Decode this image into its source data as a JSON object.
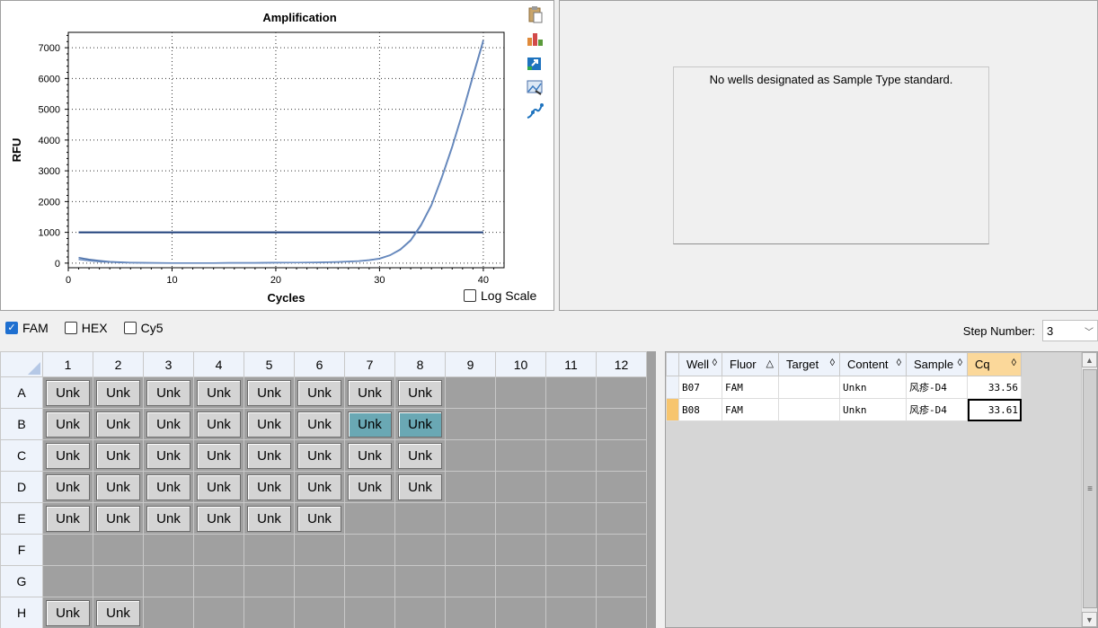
{
  "chart_data": {
    "type": "line",
    "title": "Amplification",
    "xlabel": "Cycles",
    "ylabel": "RFU",
    "xlim": [
      0,
      42
    ],
    "ylim": [
      -150,
      7500
    ],
    "x_ticks": [
      0,
      10,
      20,
      30,
      40
    ],
    "y_ticks": [
      0,
      1000,
      2000,
      3000,
      4000,
      5000,
      6000,
      7000
    ],
    "grid": true,
    "threshold": 1000,
    "series": [
      {
        "values_x": [
          1,
          2,
          3,
          4,
          5,
          6,
          8,
          10,
          12,
          14,
          16,
          18,
          20,
          22,
          24,
          26,
          28,
          29,
          30,
          31,
          32,
          33,
          34,
          35,
          36,
          37,
          38,
          39,
          40
        ],
        "values_y": [
          180,
          120,
          80,
          50,
          30,
          20,
          10,
          5,
          5,
          5,
          10,
          10,
          15,
          20,
          25,
          40,
          70,
          100,
          150,
          260,
          450,
          750,
          1250,
          1900,
          2800,
          3800,
          4900,
          6100,
          7250
        ],
        "color": "#4a6fa8"
      },
      {
        "values_x": [
          1,
          2,
          3,
          4,
          5,
          6,
          8,
          10,
          12,
          14,
          16,
          18,
          20,
          22,
          24,
          26,
          28,
          29,
          30,
          31,
          32,
          33,
          34,
          35,
          36,
          37,
          38,
          39,
          40
        ],
        "values_y": [
          120,
          80,
          50,
          30,
          20,
          10,
          5,
          0,
          0,
          0,
          5,
          5,
          10,
          15,
          20,
          35,
          60,
          90,
          140,
          250,
          430,
          730,
          1220,
          1870,
          2760,
          3760,
          4860,
          6050,
          7200
        ],
        "color": "#6a8cc0"
      }
    ]
  },
  "toolbar_icons": [
    "clipboard-icon",
    "chart-bars-icon",
    "export-icon",
    "image-icon",
    "curve-icon"
  ],
  "log_scale_label": "Log Scale",
  "std_message": "No wells designated as Sample Type standard.",
  "fluors": [
    {
      "label": "FAM",
      "checked": true
    },
    {
      "label": "HEX",
      "checked": false
    },
    {
      "label": "Cy5",
      "checked": false
    }
  ],
  "step": {
    "label": "Step Number:",
    "value": "3"
  },
  "plate": {
    "columns": [
      "1",
      "2",
      "3",
      "4",
      "5",
      "6",
      "7",
      "8",
      "9",
      "10",
      "11",
      "12"
    ],
    "rows": [
      "A",
      "B",
      "C",
      "D",
      "E",
      "F",
      "G",
      "H"
    ],
    "well_label": "Unk",
    "filled_counts": {
      "A": 8,
      "B": 8,
      "C": 8,
      "D": 8,
      "E": 6,
      "F": 0,
      "G": 0,
      "H": 2
    },
    "selected": [
      "B7",
      "B8"
    ]
  },
  "results": {
    "headers": [
      "Well",
      "Fluor",
      "Target",
      "Content",
      "Sample",
      "Cq"
    ],
    "sort_marks": [
      "◊",
      "△",
      "◊",
      "◊",
      "◊",
      "◊"
    ],
    "rows": [
      {
        "well": "B07",
        "fluor": "FAM",
        "target": "",
        "content": "Unkn",
        "sample": "风疹-D4",
        "cq": "33.56"
      },
      {
        "well": "B08",
        "fluor": "FAM",
        "target": "",
        "content": "Unkn",
        "sample": "风疹-D4",
        "cq": "33.61"
      }
    ]
  }
}
